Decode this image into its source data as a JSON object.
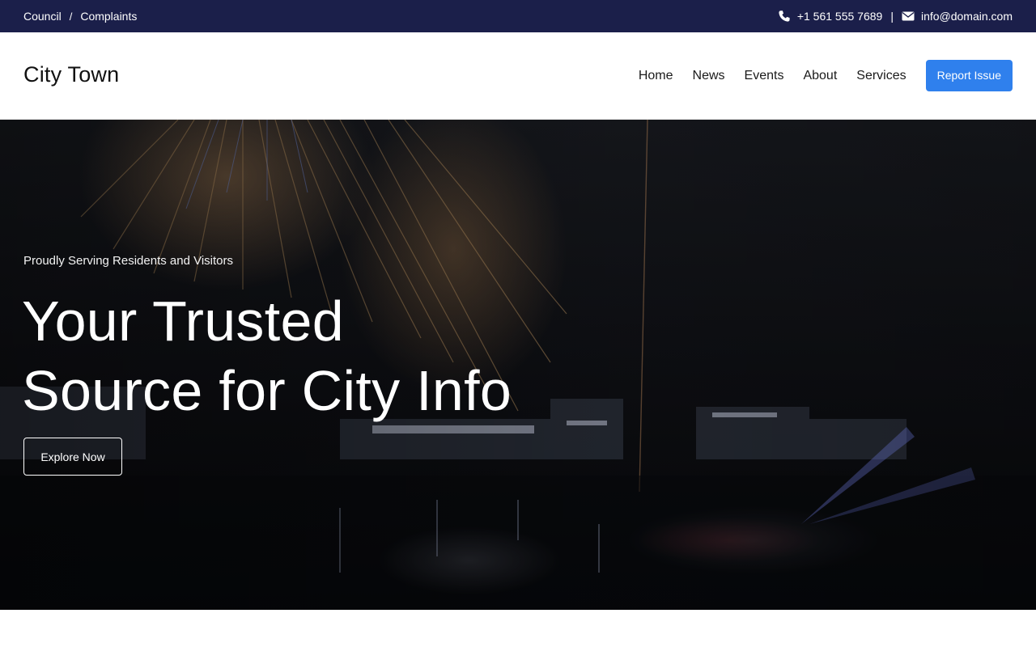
{
  "topbar": {
    "breadcrumbs": [
      "Council",
      "Complaints"
    ],
    "separator": "/",
    "phone": "+1 561 555 7689",
    "divider": "|",
    "email": "info@domain.com",
    "bg_color": "#1b1f4a"
  },
  "header": {
    "logo": "City Town",
    "nav": [
      "Home",
      "News",
      "Events",
      "About",
      "Services"
    ],
    "cta_label": "Report Issue",
    "cta_color": "#2f80ed"
  },
  "hero": {
    "tagline": "Proudly Serving Residents and Visitors",
    "title_line1": "Your Trusted",
    "title_line2": "Source for City Info",
    "button_label": "Explore Now",
    "background": "night city skyline with fireworks over water"
  },
  "icons": {
    "phone": "phone-icon",
    "email": "envelope-icon"
  }
}
